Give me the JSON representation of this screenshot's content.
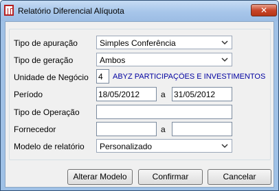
{
  "window": {
    "title": "Relatório Diferencial Alíquota",
    "close_glyph": "✕"
  },
  "form": {
    "tipo_apuracao": {
      "label": "Tipo de apuração",
      "value": "Simples Conferência"
    },
    "tipo_geracao": {
      "label": "Tipo de geração",
      "value": "Ambos"
    },
    "unidade_negocio": {
      "label": "Unidade de Negócio",
      "code": "4",
      "name": "ABYZ PARTICIPAÇÕES E INVESTIMENTOS LTD"
    },
    "periodo": {
      "label": "Período",
      "start": "18/05/2012",
      "separator": "a",
      "end": "31/05/2012"
    },
    "tipo_operacao": {
      "label": "Tipo de Operação",
      "value": ""
    },
    "fornecedor": {
      "label": "Fornecedor",
      "start": "",
      "separator": "a",
      "end": ""
    },
    "modelo_relatorio": {
      "label": "Modelo de relatório",
      "value": "Personalizado"
    }
  },
  "buttons": {
    "alterar_modelo": "Alterar Modelo",
    "confirmar": "Confirmar",
    "cancelar": "Cancelar"
  },
  "colors": {
    "title_bar": "#a7c6ea",
    "close_button": "#c8452a",
    "company_text": "#0000a0"
  }
}
